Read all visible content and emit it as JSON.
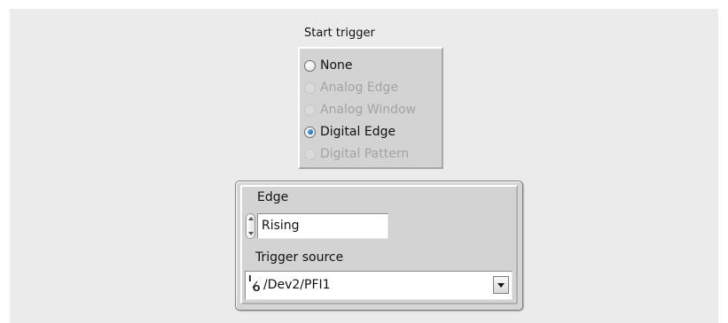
{
  "start_trigger": {
    "label": "Start trigger",
    "options": [
      {
        "label": "None",
        "enabled": true,
        "selected": false
      },
      {
        "label": "Analog Edge",
        "enabled": false,
        "selected": false
      },
      {
        "label": "Analog Window",
        "enabled": false,
        "selected": false
      },
      {
        "label": "Digital Edge",
        "enabled": true,
        "selected": true
      },
      {
        "label": "Digital Pattern",
        "enabled": false,
        "selected": false
      }
    ]
  },
  "edge": {
    "label": "Edge",
    "value": "Rising"
  },
  "trigger_source": {
    "label": "Trigger source",
    "value": "/Dev2/PFI1",
    "icon": "io-name-icon"
  },
  "colors": {
    "panel_background": "#ebebeb",
    "selected_radio": "#1768b5",
    "disabled_text": "#a3a3a3"
  }
}
